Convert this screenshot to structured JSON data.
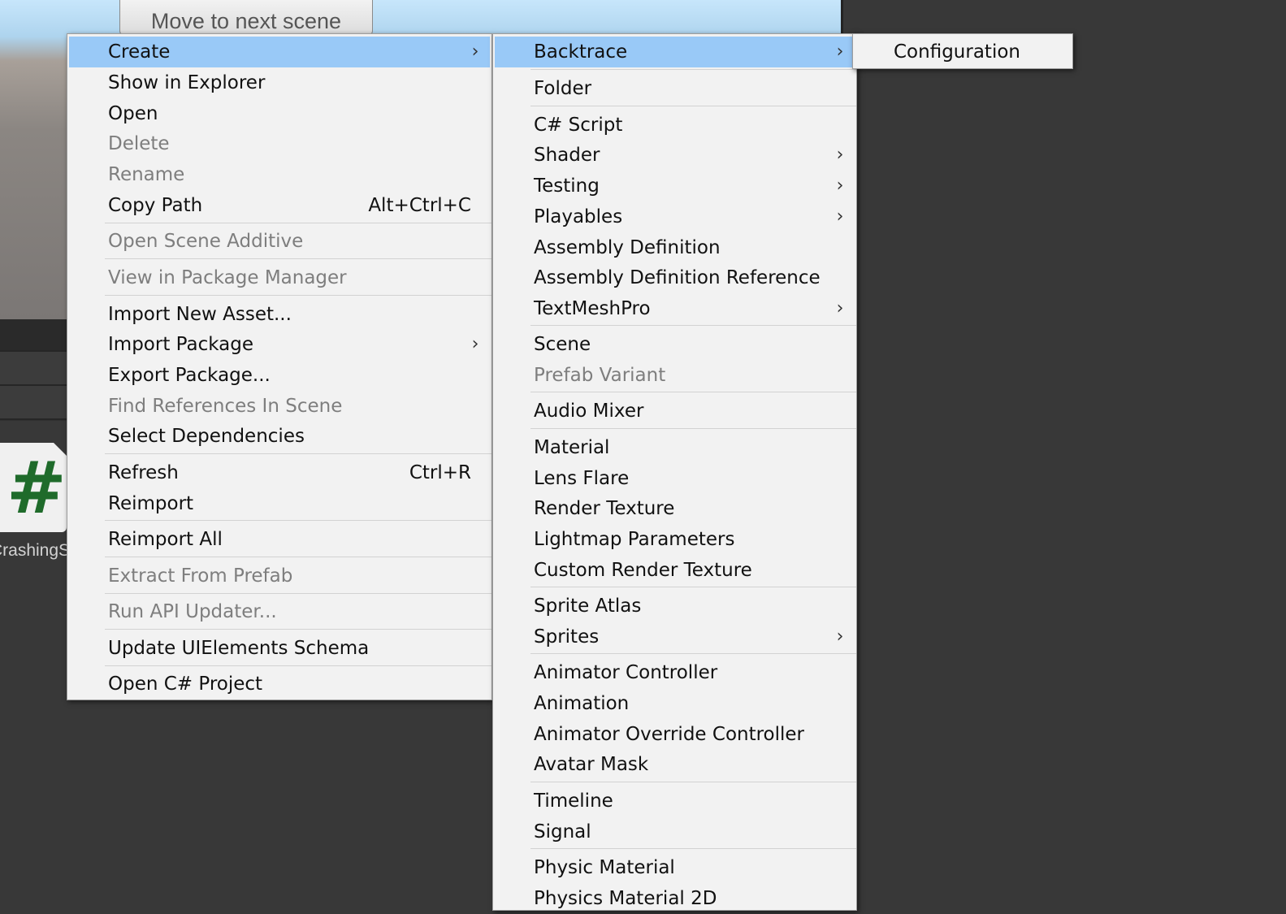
{
  "background": {
    "scene_button_label": "Move to next scene",
    "asset_icon_glyph": "#",
    "asset_name": "CrashingS"
  },
  "main_menu": {
    "items": [
      {
        "label": "Create",
        "selected": true,
        "submenu": true
      },
      {
        "label": "Show in Explorer"
      },
      {
        "label": "Open"
      },
      {
        "label": "Delete",
        "disabled": true
      },
      {
        "label": "Rename",
        "disabled": true
      },
      {
        "label": "Copy Path",
        "shortcut": "Alt+Ctrl+C"
      },
      {
        "label": "Open Scene Additive",
        "disabled": true
      },
      {
        "label": "View in Package Manager",
        "disabled": true
      },
      {
        "label": "Import New Asset..."
      },
      {
        "label": "Import Package",
        "submenu": true
      },
      {
        "label": "Export Package..."
      },
      {
        "label": "Find References In Scene",
        "disabled": true
      },
      {
        "label": "Select Dependencies"
      },
      {
        "label": "Refresh",
        "shortcut": "Ctrl+R"
      },
      {
        "label": "Reimport"
      },
      {
        "label": "Reimport All"
      },
      {
        "label": "Extract From Prefab",
        "disabled": true
      },
      {
        "label": "Run API Updater...",
        "disabled": true
      },
      {
        "label": "Update UIElements Schema"
      },
      {
        "label": "Open C# Project"
      }
    ]
  },
  "create_menu": {
    "items": [
      {
        "label": "Backtrace",
        "selected": true,
        "submenu": true
      },
      {
        "label": "Folder"
      },
      {
        "label": "C# Script"
      },
      {
        "label": "Shader",
        "submenu": true
      },
      {
        "label": "Testing",
        "submenu": true
      },
      {
        "label": "Playables",
        "submenu": true
      },
      {
        "label": "Assembly Definition"
      },
      {
        "label": "Assembly Definition Reference"
      },
      {
        "label": "TextMeshPro",
        "submenu": true
      },
      {
        "label": "Scene"
      },
      {
        "label": "Prefab Variant",
        "disabled": true
      },
      {
        "label": "Audio Mixer"
      },
      {
        "label": "Material"
      },
      {
        "label": "Lens Flare"
      },
      {
        "label": "Render Texture"
      },
      {
        "label": "Lightmap Parameters"
      },
      {
        "label": "Custom Render Texture"
      },
      {
        "label": "Sprite Atlas"
      },
      {
        "label": "Sprites",
        "submenu": true
      },
      {
        "label": "Animator Controller"
      },
      {
        "label": "Animation"
      },
      {
        "label": "Animator Override Controller"
      },
      {
        "label": "Avatar Mask"
      },
      {
        "label": "Timeline"
      },
      {
        "label": "Signal"
      },
      {
        "label": "Physic Material"
      },
      {
        "label": "Physics Material 2D"
      }
    ]
  },
  "backtrace_menu": {
    "items": [
      {
        "label": "Configuration"
      }
    ]
  },
  "icons": {
    "submenu_arrow": "chevron-right-icon",
    "submenu_arrow_glyph": "›"
  }
}
